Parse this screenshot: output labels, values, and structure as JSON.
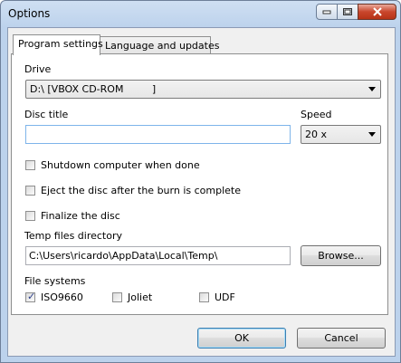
{
  "window": {
    "title": "Options"
  },
  "tabs": [
    {
      "label": "Program settings",
      "active": true
    },
    {
      "label": "Language and updates",
      "active": false
    }
  ],
  "drive": {
    "label": "Drive",
    "value": "D:\\ [VBOX CD-ROM         ]"
  },
  "disc_title": {
    "label": "Disc title",
    "value": ""
  },
  "speed": {
    "label": "Speed",
    "value": "20 x"
  },
  "options": [
    {
      "label": "Shutdown computer when done",
      "checked": false
    },
    {
      "label": "Eject the disc after the burn is complete",
      "checked": false
    },
    {
      "label": "Finalize the disc",
      "checked": false
    }
  ],
  "temp": {
    "label": "Temp files directory",
    "value": "C:\\Users\\ricardo\\AppData\\Local\\Temp\\",
    "browse_label": "Browse..."
  },
  "file_systems": {
    "label": "File systems",
    "items": [
      {
        "label": "ISO9660",
        "checked": true
      },
      {
        "label": "Joliet",
        "checked": false
      },
      {
        "label": "UDF",
        "checked": false
      }
    ]
  },
  "buttons": {
    "ok": "OK",
    "cancel": "Cancel"
  }
}
